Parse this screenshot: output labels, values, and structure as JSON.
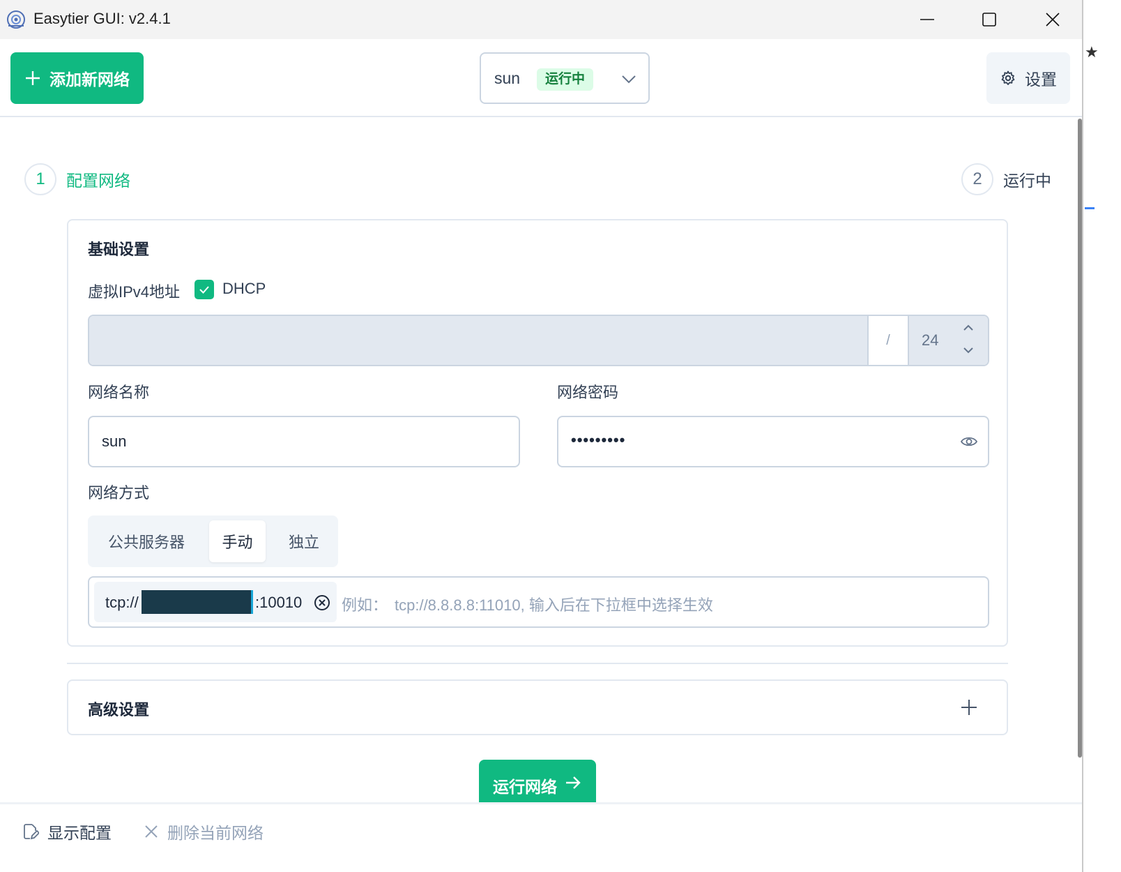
{
  "window": {
    "title": "Easytier GUI: v2.4.1",
    "icons": {
      "app": "easytier-app-icon",
      "minimize": "minimize-icon",
      "maximize": "maximize-icon",
      "close": "close-icon"
    }
  },
  "toolbar": {
    "add_network_label": "添加新网络",
    "selected_network": {
      "name": "sun",
      "status": "运行中"
    },
    "settings_label": "设置"
  },
  "steps": [
    {
      "number": "1",
      "label": "配置网络"
    },
    {
      "number": "2",
      "label": "运行中"
    }
  ],
  "basic": {
    "title": "基础设置",
    "ipv4_label": "虚拟IPv4地址",
    "dhcp_label": "DHCP",
    "dhcp_checked": true,
    "ip_value": "",
    "ip_separator": "/",
    "prefix_length": "24",
    "network_name_label": "网络名称",
    "network_name_value": "sun",
    "network_secret_label": "网络密码",
    "network_secret_value": "•••••••••",
    "network_mode_label": "网络方式",
    "network_modes": [
      "公共服务器",
      "手动",
      "独立"
    ],
    "selected_mode": "手动",
    "peer": {
      "prefix": "tcp://",
      "port_suffix": ":10010"
    },
    "peer_placeholder_label": "例如：",
    "peer_placeholder": "tcp://8.8.8.8:11010, 输入后在下拉框中选择生效"
  },
  "advanced": {
    "title": "高级设置"
  },
  "run_button_label": "运行网络",
  "footer": {
    "show_config_label": "显示配置",
    "delete_network_label": "删除当前网络"
  },
  "colors": {
    "accent": "#10b981",
    "running_tag_bg": "#dcfce7",
    "running_tag_text": "#15803d"
  }
}
